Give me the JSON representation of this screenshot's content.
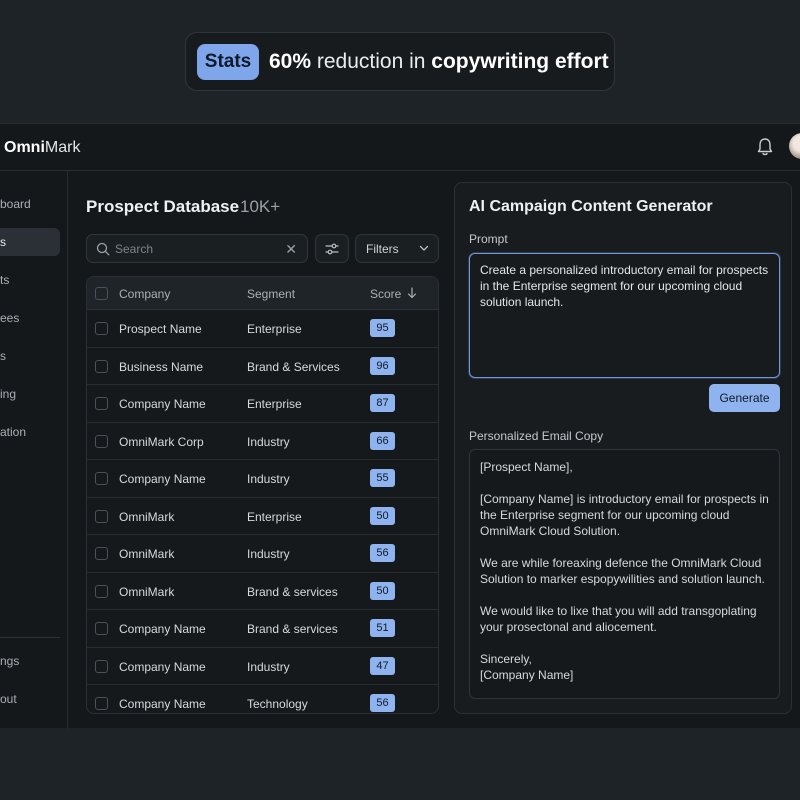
{
  "stats": {
    "badge": "Stats",
    "highlight": "60%",
    "text_mid": " reduction in ",
    "text_bold": "copywriting effort"
  },
  "brand": {
    "prefix": "Omni",
    "suffix": "Mark"
  },
  "sidebar": {
    "items": [
      {
        "label": "board"
      },
      {
        "label": "s"
      },
      {
        "label": "ts"
      },
      {
        "label": "ees"
      },
      {
        "label": "s"
      },
      {
        "label": "ing"
      },
      {
        "label": "ation"
      },
      {
        "label": "ngs"
      },
      {
        "label": "out"
      }
    ]
  },
  "prospects": {
    "title": "Prospect Database",
    "count": "10K+",
    "search_placeholder": "Search",
    "filters_label": "Filters",
    "columns": {
      "company": "Company",
      "segment": "Segment",
      "score": "Score"
    },
    "rows": [
      {
        "company": "Prospect Name",
        "segment": "Enterprise",
        "score": "95"
      },
      {
        "company": "Business Name",
        "segment": "Brand & Services",
        "score": "96"
      },
      {
        "company": "Company Name",
        "segment": "Enterprise",
        "score": "87"
      },
      {
        "company": "OmniMark Corp",
        "segment": "Industry",
        "score": "66"
      },
      {
        "company": "Company Name",
        "segment": "Industry",
        "score": "55"
      },
      {
        "company": "OmniMark",
        "segment": "Enterprise",
        "score": "50"
      },
      {
        "company": "OmniMark",
        "segment": "Industry",
        "score": "56"
      },
      {
        "company": "OmniMark",
        "segment": "Brand & services",
        "score": "50"
      },
      {
        "company": "Company Name",
        "segment": "Brand & services",
        "score": "51"
      },
      {
        "company": "Company Name",
        "segment": "Industry",
        "score": "47"
      },
      {
        "company": "Company Name",
        "segment": "Technology",
        "score": "56"
      }
    ]
  },
  "ai": {
    "title": "AI Campaign Content Generator",
    "prompt_label": "Prompt",
    "prompt_text": "Create a personalized introductory email for prospects in the Enterprise segment for our upcoming cloud solution launch.",
    "generate_label": "Generate",
    "email_label": "Personalized Email Copy",
    "email": {
      "greeting": "[Prospect Name],",
      "p1": "[Company Name] is introductory email for prospects in the Enterprise segment for our upcoming cloud OmniMark Cloud Solution.",
      "p2": "We are while foreaxing defence the OmniMark Cloud Solution to marker espopywilities and solution launch.",
      "p3": "We would like to lixe that you will add transgoplating your prosectonal and aliocement.",
      "signoff": "Sincerely,",
      "signature": "[Company Name]"
    }
  },
  "colors": {
    "accent": "#8fb3ee",
    "background": "#14181b"
  }
}
